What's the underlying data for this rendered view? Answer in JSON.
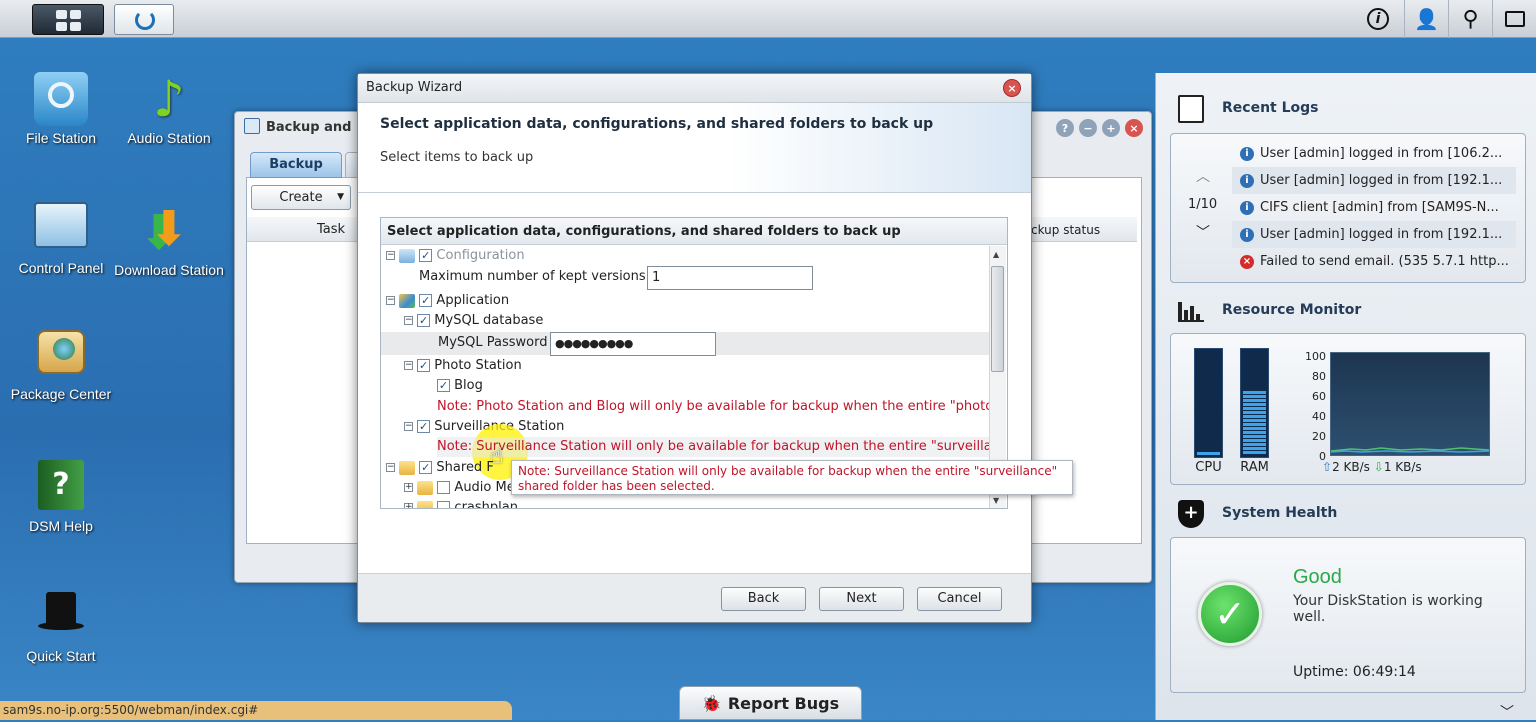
{
  "taskbar": {
    "home_label": "Main menu",
    "app_label": "Backup and Replication"
  },
  "desktop": {
    "icons": [
      {
        "label": "File Station"
      },
      {
        "label": "Audio Station"
      },
      {
        "label": "Control Panel"
      },
      {
        "label": "Download Station"
      },
      {
        "label": "Package Center"
      },
      {
        "label": "DSM Help"
      },
      {
        "label": "Quick Start"
      }
    ]
  },
  "bg_window": {
    "title": "Backup and",
    "tab": "Backup",
    "create": "Create",
    "col_task": "Task",
    "col_status": "ckup status"
  },
  "wizard": {
    "title": "Backup Wizard",
    "heading": "Select application data, configurations, and shared folders to back up",
    "subheading": "Select items to back up",
    "tree_header": "Select application data, configurations, and shared folders to back up",
    "tree": {
      "configuration": "Configuration",
      "max_versions_label": "Maximum number of kept versions",
      "max_versions_value": "1",
      "application": "Application",
      "mysql": "MySQL database",
      "mysql_pwd_label": "MySQL Password",
      "mysql_pwd_value": "●●●●●●●●●",
      "photo": "Photo Station",
      "blog": "Blog",
      "photo_note": "Note: Photo Station and Blog will only be available for backup when the entire \"photo\"",
      "surveillance": "Surveillance Station",
      "surv_note": "Note: Surveillance Station will only be available for backup when the entire \"surveillar",
      "shared": "Shared F",
      "audio": "Audio Me",
      "crashplan": "crashplan"
    },
    "tooltip": "Note: Surveillance Station will only be available for backup when the entire \"surveillance\" shared folder has been selected.",
    "buttons": {
      "back": "Back",
      "next": "Next",
      "cancel": "Cancel"
    }
  },
  "recent_logs": {
    "title": "Recent Logs",
    "page": "1/10",
    "entries": [
      {
        "text": "User [admin] logged in from [106.2...",
        "type": "info"
      },
      {
        "text": "User [admin] logged in from [192.1...",
        "type": "info"
      },
      {
        "text": "CIFS client [admin] from [SAM9S-N...",
        "type": "info"
      },
      {
        "text": "User [admin] logged in from [192.1...",
        "type": "info"
      },
      {
        "text": "Failed to send email. (535 5.7.1 http...",
        "type": "error"
      }
    ]
  },
  "resource_monitor": {
    "title": "Resource Monitor",
    "cpu_label": "CPU",
    "ram_label": "RAM",
    "cpu_level": 0.02,
    "ram_level": 0.62,
    "y_ticks": [
      "100",
      "80",
      "60",
      "40",
      "20",
      "0"
    ],
    "upload": "2 KB/s",
    "download": "1 KB/s"
  },
  "system_health": {
    "title": "System Health",
    "status": "Good",
    "message": "Your DiskStation is working well.",
    "uptime": "Uptime: 06:49:14"
  },
  "statusbar": "sam9s.no-ip.org:5500/webman/index.cgi#",
  "report_bugs": "Report Bugs",
  "colors": {
    "accent": "#2f7fc0",
    "note_red": "#c0152a",
    "good_green": "#2aa84a"
  }
}
